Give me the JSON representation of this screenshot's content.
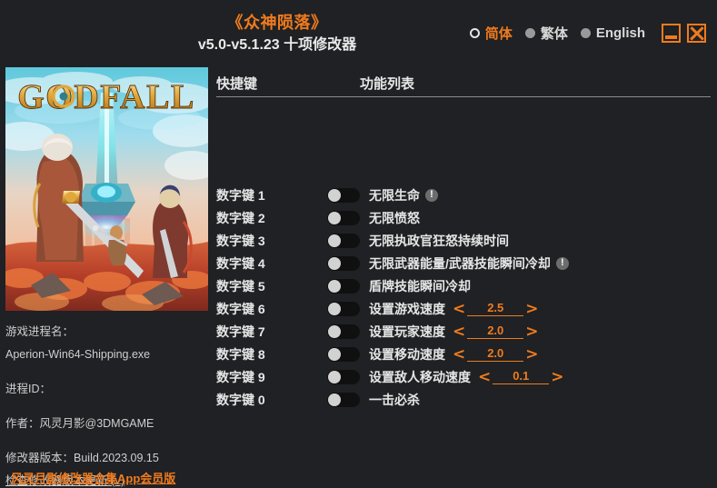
{
  "header": {
    "game_title": "《众神陨落》",
    "version_line": "v5.0-v5.1.23 十项修改器",
    "languages": [
      {
        "label": "简体",
        "selected": true
      },
      {
        "label": "繁体",
        "selected": false
      },
      {
        "label": "English",
        "selected": false
      }
    ],
    "window_buttons": {
      "minimize": "minimize-icon",
      "close": "close-icon"
    }
  },
  "cover": {
    "logo_text": "GODFALL",
    "alt": "Godfall game cover art"
  },
  "sidebar": {
    "process_name_label": "游戏进程名：",
    "process_name_value": "Aperion-Win64-Shipping.exe",
    "process_id_label": "进程ID：",
    "process_id_value": "",
    "author_line": "作者：风灵月影@3DMGAME",
    "trainer_version_line": "修改器版本：Build.2023.09.15",
    "update_link": "检查修改器版本更新 (√)",
    "app_link": "风灵月影修改器合集App会员版"
  },
  "table": {
    "headers": {
      "hotkey": "快捷键",
      "function": "功能列表"
    },
    "rows": [
      {
        "key": "数字键 1",
        "label": "无限生命",
        "toggle": false,
        "warn": true,
        "stepper": null
      },
      {
        "key": "数字键 2",
        "label": "无限愤怒",
        "toggle": false,
        "warn": false,
        "stepper": null
      },
      {
        "key": "数字键 3",
        "label": "无限执政官狂怒持续时间",
        "toggle": false,
        "warn": false,
        "stepper": null
      },
      {
        "key": "数字键 4",
        "label": "无限武器能量/武器技能瞬间冷却",
        "toggle": false,
        "warn": true,
        "stepper": null
      },
      {
        "key": "数字键 5",
        "label": "盾牌技能瞬间冷却",
        "toggle": false,
        "warn": false,
        "stepper": null
      },
      {
        "key": "数字键 6",
        "label": "设置游戏速度",
        "toggle": false,
        "warn": false,
        "stepper": {
          "value": "2.5",
          "dec": "<",
          "inc": ">"
        }
      },
      {
        "key": "数字键 7",
        "label": "设置玩家速度",
        "toggle": false,
        "warn": false,
        "stepper": {
          "value": "2.0",
          "dec": "<",
          "inc": ">"
        }
      },
      {
        "key": "数字键 8",
        "label": "设置移动速度",
        "toggle": false,
        "warn": false,
        "stepper": {
          "value": "2.0",
          "dec": "<",
          "inc": ">"
        }
      },
      {
        "key": "数字键 9",
        "label": "设置敌人移动速度",
        "toggle": false,
        "warn": false,
        "stepper": {
          "value": "0.1",
          "dec": "<",
          "inc": ">"
        }
      },
      {
        "key": "数字键 0",
        "label": "一击必杀",
        "toggle": false,
        "warn": false,
        "stepper": null
      }
    ]
  },
  "colors": {
    "accent": "#f07b1d",
    "background": "#1f2124",
    "text": "#e6e6e6",
    "muted": "#cfcfcf"
  }
}
